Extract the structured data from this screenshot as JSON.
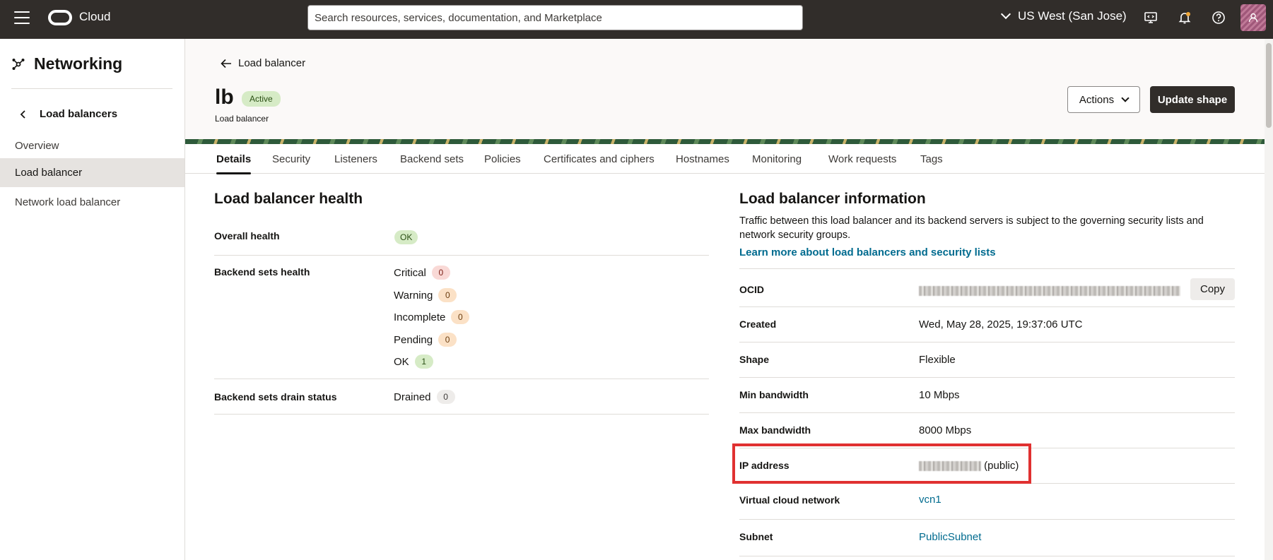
{
  "topbar": {
    "brand": "Cloud",
    "search_placeholder": "Search resources, services, documentation, and Marketplace",
    "region": "US West (San Jose)",
    "icons": [
      "hamburger-icon",
      "oracle-logo-icon",
      "chevron-down-icon",
      "developer-tools-icon",
      "notifications-bell-icon",
      "help-icon",
      "user-avatar-icon"
    ]
  },
  "sidebar": {
    "title": "Networking",
    "back_label": "Load balancers",
    "items": [
      {
        "label": "Overview",
        "active": false
      },
      {
        "label": "Load balancer",
        "active": true
      },
      {
        "label": "Network load balancer",
        "active": false
      }
    ]
  },
  "header": {
    "back_label": "Load balancer",
    "name": "lb",
    "status": "Active",
    "type": "Load balancer",
    "actions_label": "Actions",
    "update_label": "Update shape"
  },
  "tabs": [
    {
      "label": "Details",
      "active": true
    },
    {
      "label": "Security"
    },
    {
      "label": "Listeners"
    },
    {
      "label": "Backend sets"
    },
    {
      "label": "Policies"
    },
    {
      "label": "Certificates and ciphers"
    },
    {
      "label": "Hostnames"
    },
    {
      "label": "Monitoring"
    },
    {
      "label": "Work requests"
    },
    {
      "label": "Tags"
    }
  ],
  "health": {
    "title": "Load balancer health",
    "overall_label": "Overall health",
    "overall_value": "OK",
    "backend_sets_label": "Backend sets health",
    "counts": [
      {
        "label": "Critical",
        "value": "0"
      },
      {
        "label": "Warning",
        "value": "0"
      },
      {
        "label": "Incomplete",
        "value": "0"
      },
      {
        "label": "Pending",
        "value": "0"
      },
      {
        "label": "OK",
        "value": "1"
      }
    ],
    "drain_label": "Backend sets drain status",
    "drain_item": {
      "label": "Drained",
      "value": "0"
    }
  },
  "info": {
    "title": "Load balancer information",
    "description": "Traffic between this load balancer and its backend servers is subject to the governing security lists and network security groups.",
    "learn_more": "Learn more about load balancers and security lists",
    "copy_label": "Copy",
    "rows": {
      "ocid": {
        "label": "OCID"
      },
      "created": {
        "label": "Created",
        "value": "Wed, May 28, 2025, 19:37:06 UTC"
      },
      "shape": {
        "label": "Shape",
        "value": "Flexible"
      },
      "min_bw": {
        "label": "Min bandwidth",
        "value": "10 Mbps"
      },
      "max_bw": {
        "label": "Max bandwidth",
        "value": "8000 Mbps"
      },
      "ip": {
        "label": "IP address",
        "suffix": "(public)"
      },
      "vcn": {
        "label": "Virtual cloud network",
        "value": "vcn1"
      },
      "subnet": {
        "label": "Subnet",
        "value": "PublicSubnet"
      }
    }
  },
  "colors": {
    "topbar": "#312d2a",
    "link": "#006b8f",
    "highlight": "#e03131",
    "active_badge": "#d6ebc6"
  }
}
